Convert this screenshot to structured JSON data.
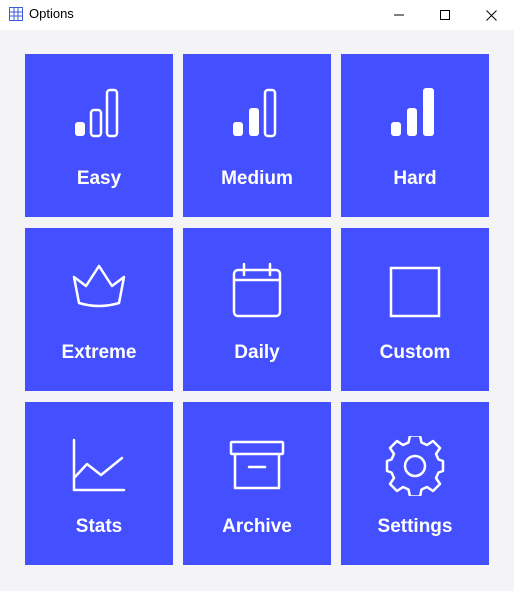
{
  "window": {
    "title": "Options",
    "controls": {
      "minimize_icon": "minimize-icon",
      "maximize_icon": "maximize-icon",
      "close_icon": "close-icon"
    }
  },
  "colors": {
    "tile_background": "#4450ff",
    "tile_text": "#ffffff",
    "window_background": "#f4f4f6"
  },
  "tiles": [
    {
      "label": "Easy",
      "icon": "signal-bars-low-icon"
    },
    {
      "label": "Medium",
      "icon": "signal-bars-medium-icon"
    },
    {
      "label": "Hard",
      "icon": "signal-bars-full-icon"
    },
    {
      "label": "Extreme",
      "icon": "crown-icon"
    },
    {
      "label": "Daily",
      "icon": "calendar-icon"
    },
    {
      "label": "Custom",
      "icon": "square-icon"
    },
    {
      "label": "Stats",
      "icon": "line-chart-icon"
    },
    {
      "label": "Archive",
      "icon": "archive-box-icon"
    },
    {
      "label": "Settings",
      "icon": "gear-icon"
    }
  ]
}
